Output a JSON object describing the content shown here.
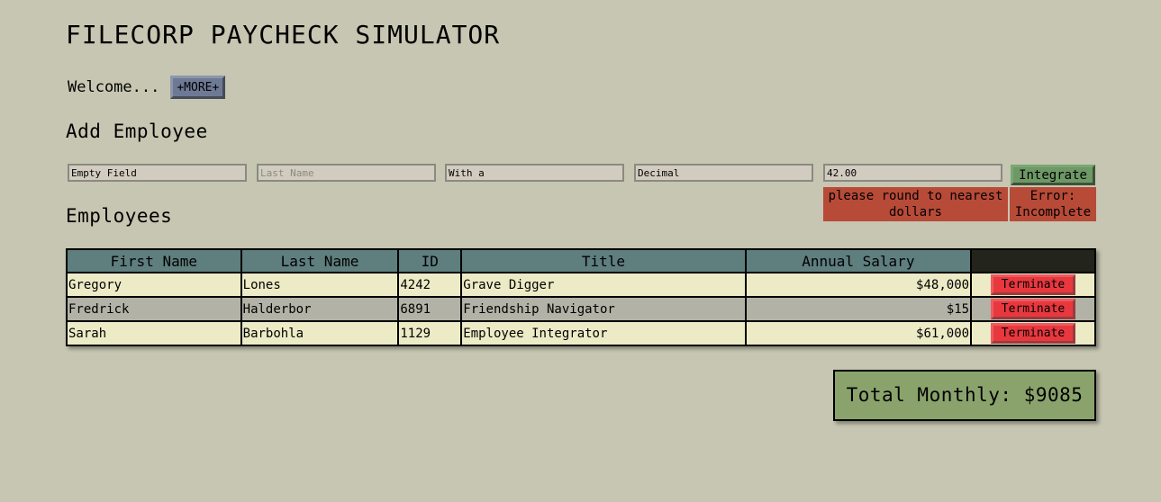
{
  "app": {
    "title": "FILECORP PAYCHECK SIMULATOR"
  },
  "welcome": {
    "text": "Welcome...",
    "more_label": "+MORE+"
  },
  "add_employee": {
    "heading": "Add Employee",
    "fields": [
      {
        "value": "Empty Field",
        "placeholder": "First Name"
      },
      {
        "value": "",
        "placeholder": "Last Name"
      },
      {
        "value": "With a",
        "placeholder": "ID"
      },
      {
        "value": "Decimal",
        "placeholder": "Title"
      },
      {
        "value": "42.00",
        "placeholder": "Annual Salary"
      }
    ],
    "submit_label": "Integrate",
    "salary_error": "please round to nearest dollars",
    "form_error": "Error: Incomplete"
  },
  "employees": {
    "heading": "Employees",
    "columns": [
      "First Name",
      "Last Name",
      "ID",
      "Title",
      "Annual Salary"
    ],
    "rows": [
      {
        "first": "Gregory",
        "last": "Lones",
        "id": "4242",
        "title": "Grave Digger",
        "salary": "$48,000",
        "action": "Terminate"
      },
      {
        "first": "Fredrick",
        "last": "Halderbor",
        "id": "6891",
        "title": "Friendship Navigator",
        "salary": "$15",
        "action": "Terminate"
      },
      {
        "first": "Sarah",
        "last": "Barbohla",
        "id": "1129",
        "title": "Employee Integrator",
        "salary": "$61,000",
        "action": "Terminate"
      }
    ]
  },
  "total": {
    "label": "Total Monthly: $9085"
  },
  "colors": {
    "background": "#c6c6b2",
    "header": "#5f7e7e",
    "row_light": "#ecebc6",
    "row_dark": "#b2b2a6",
    "terminate": "#e8383e",
    "error": "#b84a38",
    "total": "#8aa36c",
    "more_button": "#6e7a95",
    "integrate_button": "#6e9866"
  }
}
